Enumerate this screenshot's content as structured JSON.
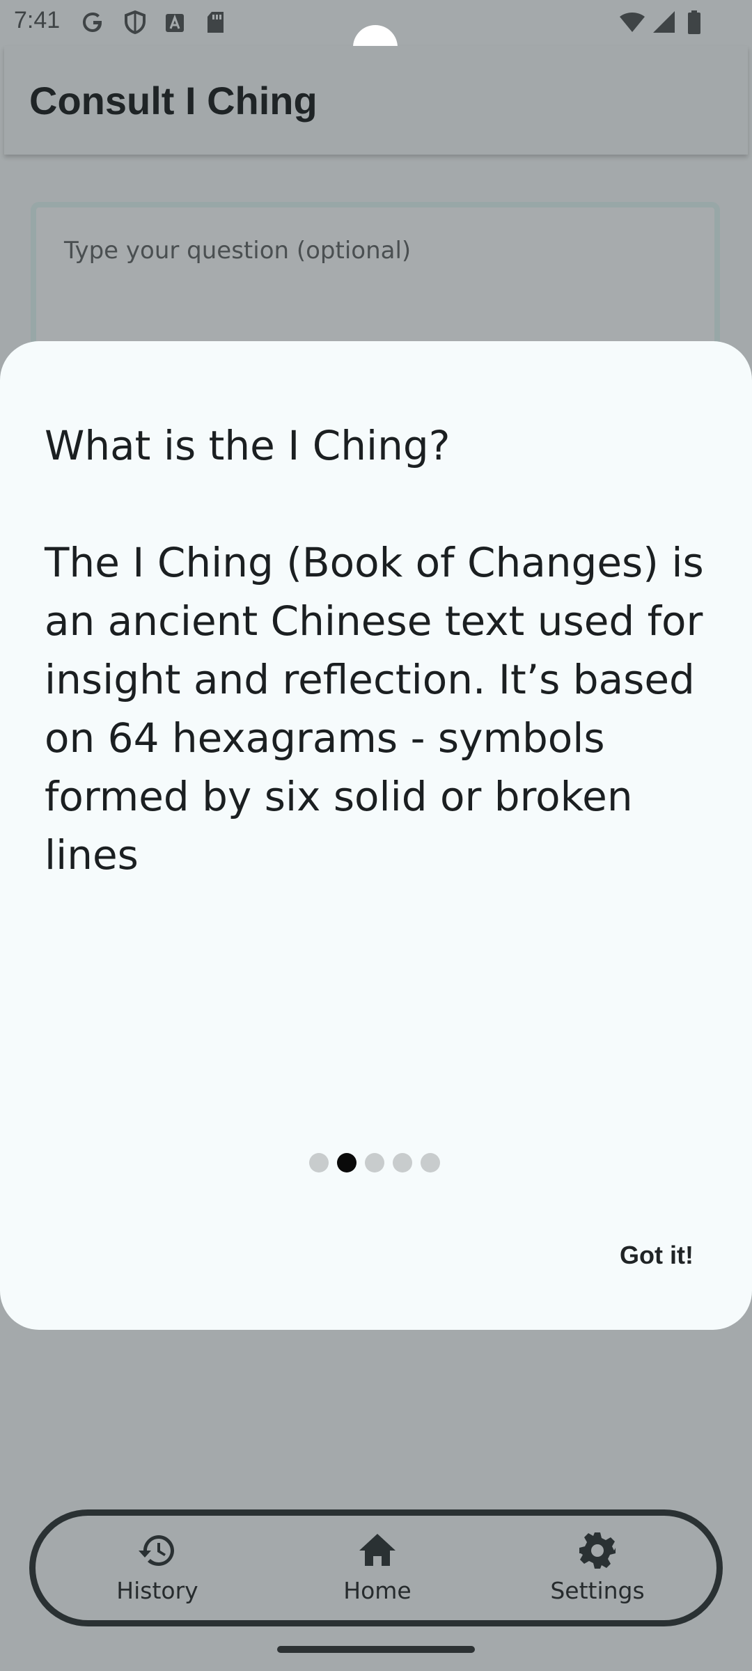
{
  "status_bar": {
    "time": "7:41",
    "left_icons": [
      "google-icon",
      "shield-icon",
      "font-a-icon",
      "sd-card-icon"
    ],
    "right_icons": [
      "wifi-icon",
      "signal-icon",
      "battery-icon"
    ]
  },
  "app_bar": {
    "title": "Consult I Ching"
  },
  "question_input": {
    "placeholder": "Type your question (optional)"
  },
  "info_sheet": {
    "heading": "What is the I Ching?",
    "body": "The I Ching (Book of Changes) is an ancient Chinese text used for insight and reflection. It’s based on 64 hexagrams - symbols formed by six solid or broken lines",
    "pages_total": 5,
    "current_page": 2,
    "dismiss_label": "Got it!"
  },
  "bottom_nav": {
    "items": [
      {
        "label": "History",
        "icon": "history-icon"
      },
      {
        "label": "Home",
        "icon": "home-icon"
      },
      {
        "label": "Settings",
        "icon": "gear-icon"
      }
    ]
  },
  "colors": {
    "scrim": "#a4a9ab",
    "sheet": "#f6fbfc",
    "text": "#1b1f21",
    "dot_active": "#0a0a0a",
    "dot_inactive": "#c8cccd"
  }
}
